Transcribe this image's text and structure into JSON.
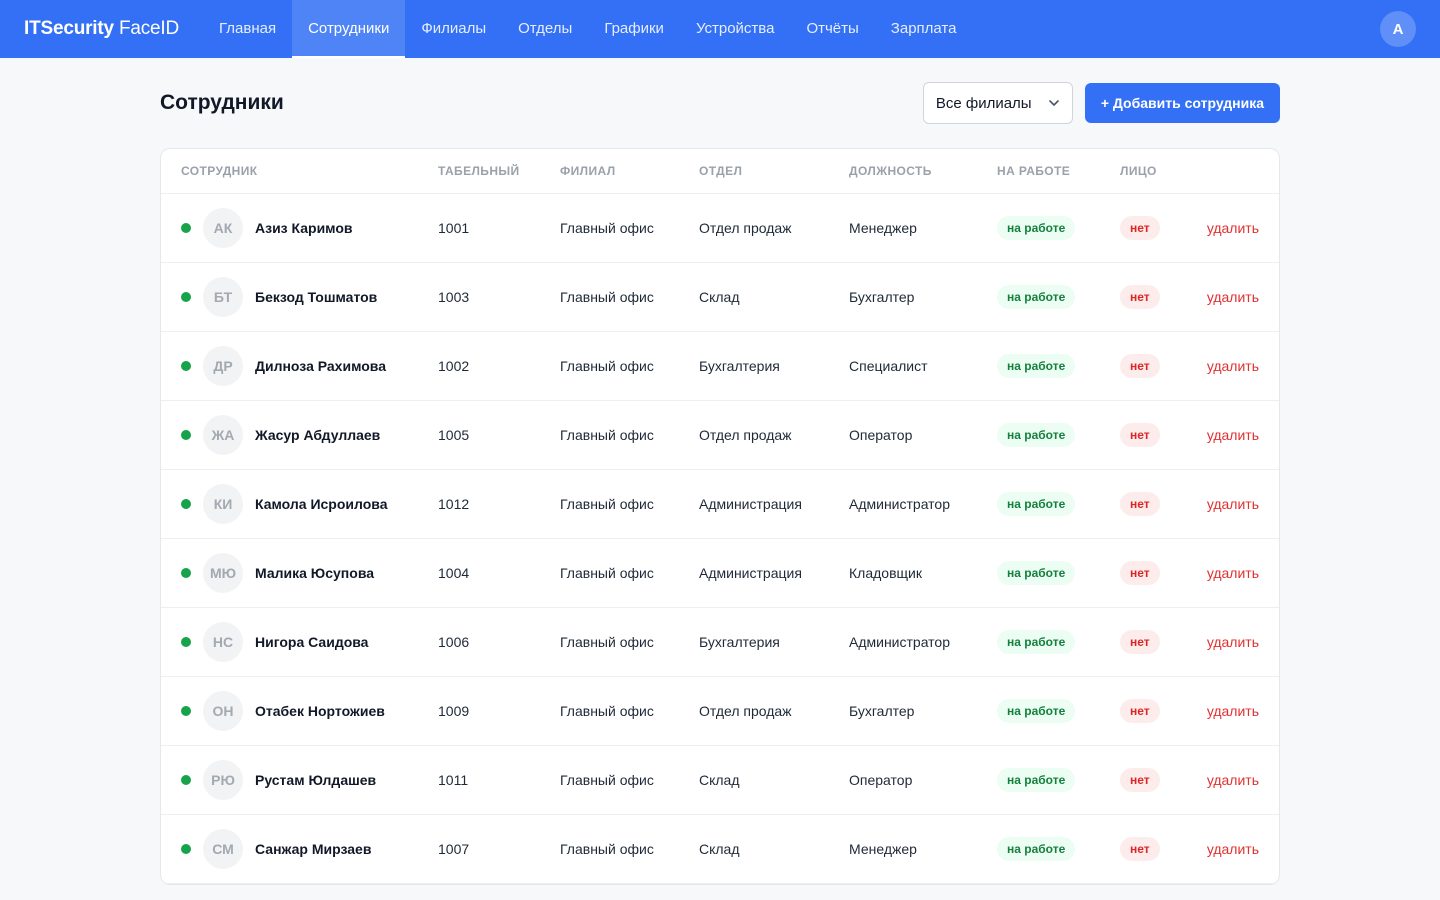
{
  "header": {
    "brand_bold": "ITSecurity",
    "brand_thin": " FaceID",
    "nav": [
      {
        "label": "Главная"
      },
      {
        "label": "Сотрудники"
      },
      {
        "label": "Филиалы"
      },
      {
        "label": "Отделы"
      },
      {
        "label": "Графики"
      },
      {
        "label": "Устройства"
      },
      {
        "label": "Отчёты"
      },
      {
        "label": "Зарплата"
      }
    ],
    "active_nav": "Сотрудники",
    "user_initial": "A"
  },
  "page": {
    "title": "Сотрудники",
    "branch_filter": "Все филиалы",
    "add_button": "+ Добавить сотрудника"
  },
  "table": {
    "columns": [
      "СОТРУДНИК",
      "ТАБЕЛЬНЫЙ",
      "ФИЛИАЛ",
      "ОТДЕЛ",
      "ДОЛЖНОСТЬ",
      "НА РАБОТЕ",
      "ЛИЦО"
    ],
    "rows": [
      {
        "initials": "АК",
        "name": "Азиз Каримов",
        "id": "1001",
        "branch": "Главный офис",
        "dept": "Отдел продаж",
        "position": "Менеджер",
        "status": "на работе",
        "face": "нет",
        "action": "удалить"
      },
      {
        "initials": "БТ",
        "name": "Бекзод Тошматов",
        "id": "1003",
        "branch": "Главный офис",
        "dept": "Склад",
        "position": "Бухгалтер",
        "status": "на работе",
        "face": "нет",
        "action": "удалить"
      },
      {
        "initials": "ДР",
        "name": "Дилноза Рахимова",
        "id": "1002",
        "branch": "Главный офис",
        "dept": "Бухгалтерия",
        "position": "Специалист",
        "status": "на работе",
        "face": "нет",
        "action": "удалить"
      },
      {
        "initials": "ЖА",
        "name": "Жасур Абдуллаев",
        "id": "1005",
        "branch": "Главный офис",
        "dept": "Отдел продаж",
        "position": "Оператор",
        "status": "на работе",
        "face": "нет",
        "action": "удалить"
      },
      {
        "initials": "КИ",
        "name": "Камола Исроилова",
        "id": "1012",
        "branch": "Главный офис",
        "dept": "Администрация",
        "position": "Администратор",
        "status": "на работе",
        "face": "нет",
        "action": "удалить"
      },
      {
        "initials": "МЮ",
        "name": "Малика Юсупова",
        "id": "1004",
        "branch": "Главный офис",
        "dept": "Администрация",
        "position": "Кладовщик",
        "status": "на работе",
        "face": "нет",
        "action": "удалить"
      },
      {
        "initials": "НС",
        "name": "Нигора Саидова",
        "id": "1006",
        "branch": "Главный офис",
        "dept": "Бухгалтерия",
        "position": "Администратор",
        "status": "на работе",
        "face": "нет",
        "action": "удалить"
      },
      {
        "initials": "ОН",
        "name": "Отабек Нортожиев",
        "id": "1009",
        "branch": "Главный офис",
        "dept": "Отдел продаж",
        "position": "Бухгалтер",
        "status": "на работе",
        "face": "нет",
        "action": "удалить"
      },
      {
        "initials": "РЮ",
        "name": "Рустам Юлдашев",
        "id": "1011",
        "branch": "Главный офис",
        "dept": "Склад",
        "position": "Оператор",
        "status": "на работе",
        "face": "нет",
        "action": "удалить"
      },
      {
        "initials": "СМ",
        "name": "Санжар Мирзаев",
        "id": "1007",
        "branch": "Главный офис",
        "dept": "Склад",
        "position": "Менеджер",
        "status": "на работе",
        "face": "нет",
        "action": "удалить"
      }
    ]
  },
  "colors": {
    "brand": "#3370f5",
    "online": "#16a34a",
    "danger": "#e03131"
  }
}
